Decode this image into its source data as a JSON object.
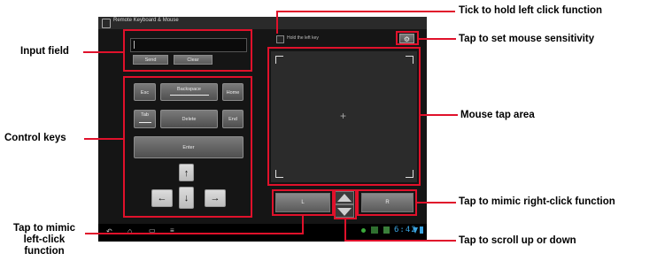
{
  "app": {
    "title": "Remote Keyboard & Mouse"
  },
  "input": {
    "send_label": "Send",
    "clear_label": "Clear"
  },
  "keys": {
    "esc": "Esc",
    "backspace": "Backspace",
    "home": "Home",
    "tab": "Tab",
    "delete": "Delete",
    "end": "End",
    "enter": "Enter",
    "up": "↑",
    "left": "←",
    "down": "↓",
    "right": "→"
  },
  "mouse": {
    "hold_label": "Hold the left key",
    "gear": "⚙",
    "crosshair": "+",
    "left_label": "L",
    "right_label": "R"
  },
  "navbar": {
    "time": "6:42",
    "back": "↶",
    "home": "⌂",
    "recents": "▭",
    "menu": "≡"
  },
  "callouts": {
    "input_field": "Input field",
    "control_keys": "Control keys",
    "left_click": "Tap to mimic\nleft-click\nfunction",
    "hold_left": "Tick to hold left click function",
    "sensitivity": "Tap to set mouse sensitivity",
    "tap_area": "Mouse tap area",
    "right_click": "Tap to mimic right-click function",
    "scroll": "Tap to scroll up or down"
  },
  "colors": {
    "callout_red": "#e0112b"
  }
}
